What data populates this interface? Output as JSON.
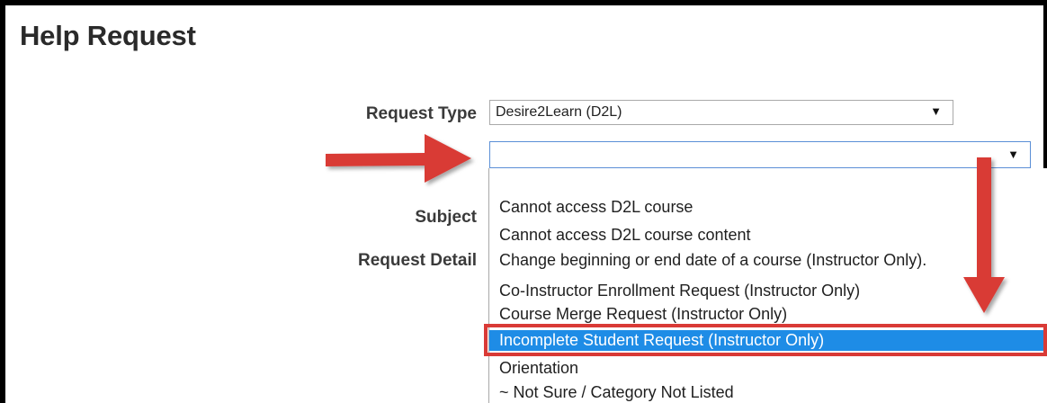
{
  "page": {
    "title": "Help Request"
  },
  "form": {
    "request_type_label": "Request Type",
    "request_type_value": "Desire2Learn (D2L)",
    "subject_label": "Subject",
    "request_detail_label": "Request Detail",
    "category_value": ""
  },
  "dropdown": {
    "options": [
      "",
      "Cannot access D2L course",
      "Cannot access D2L course content",
      "Change beginning or end date of a course (Instructor Only).",
      "Co-Instructor Enrollment Request (Instructor Only)",
      "Course Merge Request (Instructor Only)",
      "Incomplete Student Request (Instructor Only)",
      "Orientation",
      "~ Not Sure / Category Not Listed"
    ],
    "selected_index": 6
  },
  "icons": {
    "select_arrow": "triangle-down-icon",
    "annotation_arrow": "red-arrow-icon"
  },
  "colors": {
    "selected_bg": "#1e8ce6",
    "annotation_red": "#d93a36"
  }
}
